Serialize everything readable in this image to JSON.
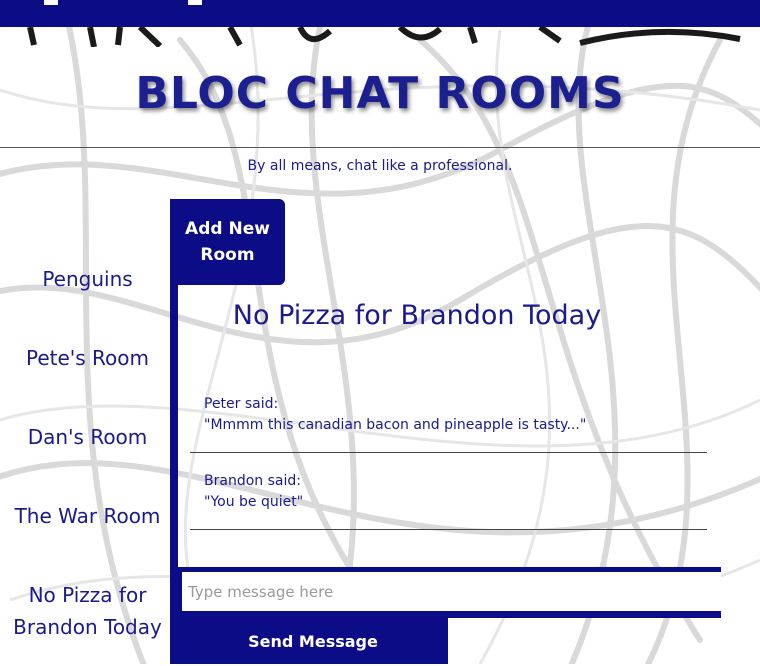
{
  "header": {
    "title": "BLOC CHAT ROOMS",
    "tagline": "By all means, chat like a professional."
  },
  "sidebar": {
    "rooms": [
      {
        "label": "Penguins"
      },
      {
        "label": "Pete's Room"
      },
      {
        "label": "Dan's Room"
      },
      {
        "label": "The War Room"
      },
      {
        "label": "No Pizza for Brandon Today"
      }
    ]
  },
  "panel": {
    "add_room_label": "Add New Room",
    "active_room": "No Pizza for Brandon Today",
    "messages": [
      {
        "author": "Peter said:",
        "text": "\"Mmmm this canadian bacon and pineapple is tasty...\""
      },
      {
        "author": "Brandon said:",
        "text": "\"You be quiet\""
      }
    ],
    "input_placeholder": "Type message here",
    "send_label": "Send Message"
  },
  "colors": {
    "accent": "#0c0c86",
    "text": "#1a1a8c",
    "background": "#ffffff"
  }
}
